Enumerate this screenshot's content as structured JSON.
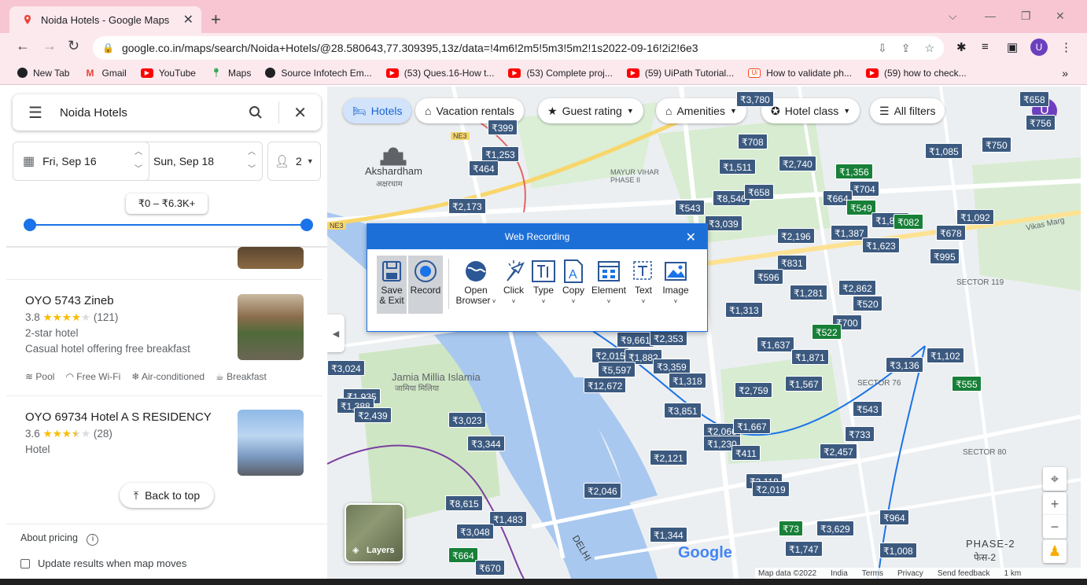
{
  "browser": {
    "tab_title": "Noida Hotels - Google Maps",
    "url": "google.co.in/maps/search/Noida+Hotels/@28.580643,77.309395,13z/data=!4m6!2m5!5m3!5m2!1s2022-09-16!2i2!6e3",
    "profile_initial": "U",
    "bookmarks": [
      {
        "label": "New Tab",
        "icon": "globe-icon",
        "color": "#202124"
      },
      {
        "label": "Gmail",
        "icon": "gmail-icon",
        "color": "#ea4335"
      },
      {
        "label": "YouTube",
        "icon": "youtube-icon",
        "color": "#ff0000"
      },
      {
        "label": "Maps",
        "icon": "maps-icon",
        "color": "#34a853"
      },
      {
        "label": "Source Infotech Em...",
        "icon": "globe-icon",
        "color": "#202124"
      },
      {
        "label": "(53) Ques.16-How t...",
        "icon": "youtube-icon",
        "color": "#ff0000"
      },
      {
        "label": "(53) Complete proj...",
        "icon": "youtube-icon",
        "color": "#ff0000"
      },
      {
        "label": "(59) UiPath Tutorial...",
        "icon": "youtube-icon",
        "color": "#ff0000"
      },
      {
        "label": "How to validate ph...",
        "icon": "uipath-icon",
        "color": "#fa4616"
      },
      {
        "label": "(59) how to check...",
        "icon": "youtube-icon",
        "color": "#ff0000"
      }
    ],
    "overflow": "»"
  },
  "search": {
    "query": "Noida Hotels"
  },
  "dates": {
    "checkin": "Fri, Sep 16",
    "checkout": "Sun, Sep 18",
    "guests": "2"
  },
  "price_range": "₹0 – ₹6.3K+",
  "hotels": [
    {
      "name": "OYO 5743 Zineb",
      "rating": "3.8",
      "stars": 4,
      "reviews": "(121)",
      "class": "2-star hotel",
      "desc": "Casual hotel offering free breakfast",
      "amenities": [
        "Pool",
        "Free Wi-Fi",
        "Air-conditioned",
        "Breakfast"
      ]
    },
    {
      "name": "OYO 69734 Hotel A S RESIDENCY",
      "rating": "3.6",
      "stars": 3.5,
      "reviews": "(28)",
      "class": "Hotel",
      "desc": ""
    }
  ],
  "back_to_top": "Back to top",
  "about_pricing": "About pricing",
  "update_results": "Update results when map moves",
  "filters": [
    "Hotels",
    "Vacation rentals",
    "Guest rating",
    "Amenities",
    "Hotel class",
    "All filters"
  ],
  "map_labels": {
    "akshardham": "Akshardham",
    "akshardham_hi": "अक्षरधाम",
    "jamia": "Jamia Millia Islamia",
    "jamia_hi": "जामिया मिलिया",
    "mayur": "MAYUR VIHAR PHASE II",
    "sector119": "SECTOR 119",
    "sector76": "SECTOR 76",
    "sector80": "SECTOR 80",
    "phase2": "PHASE-2",
    "phase2_hi": "फेस-2",
    "delhi": "DELHI",
    "vikas": "Vikas Marg",
    "ne3": "NE3",
    "google": "Google",
    "layers": "Layers"
  },
  "attribution": [
    "Map data ©2022",
    "India",
    "Terms",
    "Privacy",
    "Send feedback",
    "1 km"
  ],
  "price_pins": [
    {
      "t": "₹3,780"
    },
    {
      "t": "₹658"
    },
    {
      "t": "₹756"
    },
    {
      "t": "₹399"
    },
    {
      "t": "₹1,253"
    },
    {
      "t": "₹464"
    },
    {
      "t": "₹708"
    },
    {
      "t": "₹1,511"
    },
    {
      "t": "₹2,740"
    },
    {
      "t": "₹1,356",
      "g": true
    },
    {
      "t": "₹704"
    },
    {
      "t": "₹1,085"
    },
    {
      "t": "₹750"
    },
    {
      "t": "₹8,546"
    },
    {
      "t": "₹658"
    },
    {
      "t": "₹664"
    },
    {
      "t": "₹549",
      "g": true
    },
    {
      "t": "₹2,173"
    },
    {
      "t": "₹543"
    },
    {
      "t": "₹3,039"
    },
    {
      "t": "₹1,875"
    },
    {
      "t": "₹082",
      "g": true
    },
    {
      "t": "₹1,092"
    },
    {
      "t": "₹2,196"
    },
    {
      "t": "₹1,387"
    },
    {
      "t": "₹678"
    },
    {
      "t": "₹1,623"
    },
    {
      "t": "₹995"
    },
    {
      "t": "₹831"
    },
    {
      "t": "₹596"
    },
    {
      "t": "₹1,281"
    },
    {
      "t": "₹2,862"
    },
    {
      "t": "₹520"
    },
    {
      "t": "₹1,313"
    },
    {
      "t": "₹700"
    },
    {
      "t": "₹522",
      "g": true
    },
    {
      "t": "₹9,661"
    },
    {
      "t": "₹2,353"
    },
    {
      "t": "₹1,637"
    },
    {
      "t": "₹2,015"
    },
    {
      "t": "₹1,882"
    },
    {
      "t": "₹1,871"
    },
    {
      "t": "₹3,136"
    },
    {
      "t": "₹1,102"
    },
    {
      "t": "₹5,597"
    },
    {
      "t": "₹3,359"
    },
    {
      "t": "₹12,672"
    },
    {
      "t": "₹1,318"
    },
    {
      "t": "₹2,759"
    },
    {
      "t": "₹1,567"
    },
    {
      "t": "₹555",
      "g": true
    },
    {
      "t": "₹3,024"
    },
    {
      "t": "₹1,935"
    },
    {
      "t": "₹1,388"
    },
    {
      "t": "₹2,439"
    },
    {
      "t": "₹3,023"
    },
    {
      "t": "₹3,851"
    },
    {
      "t": "₹543"
    },
    {
      "t": "₹3,344"
    },
    {
      "t": "₹2,066"
    },
    {
      "t": "₹1,667"
    },
    {
      "t": "₹733"
    },
    {
      "t": "₹1,230"
    },
    {
      "t": "₹411"
    },
    {
      "t": "₹2,457"
    },
    {
      "t": "₹2,121"
    },
    {
      "t": "₹3,118"
    },
    {
      "t": "₹2,019"
    },
    {
      "t": "₹2,046"
    },
    {
      "t": "₹8,615"
    },
    {
      "t": "₹1,483"
    },
    {
      "t": "₹3,048"
    },
    {
      "t": "₹964"
    },
    {
      "t": "₹73",
      "g": true
    },
    {
      "t": "₹3,629"
    },
    {
      "t": "₹1,344"
    },
    {
      "t": "₹1,747"
    },
    {
      "t": "₹1,008"
    },
    {
      "t": "₹664",
      "g": true
    },
    {
      "t": "₹670"
    }
  ],
  "recorder": {
    "title": "Web Recording",
    "buttons": [
      "Save & Exit",
      "Record",
      "Open Browser",
      "Click",
      "Type",
      "Copy",
      "Element",
      "Text",
      "Image"
    ]
  }
}
